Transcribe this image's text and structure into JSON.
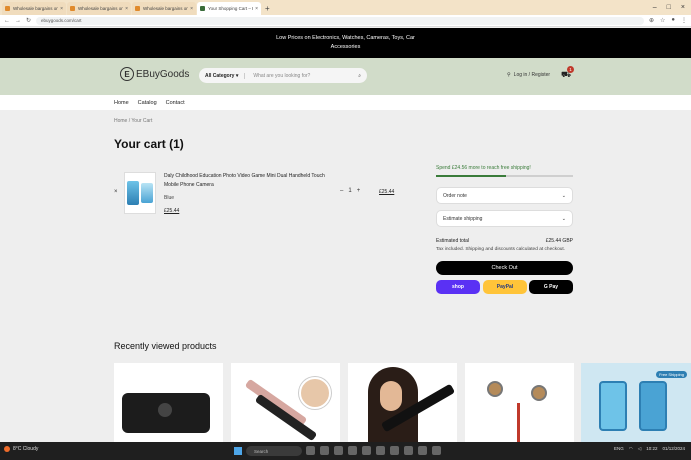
{
  "browser": {
    "tabs": [
      {
        "label": "Wholesale bargains online...",
        "active": false
      },
      {
        "label": "Wholesale bargains online...",
        "active": false
      },
      {
        "label": "Wholesale bargains online...",
        "active": false
      },
      {
        "label": "Your Shopping Cart – EBuyGoods",
        "active": true
      }
    ],
    "url": "ebuygoods.com/cart"
  },
  "announcement": "Low Prices on Electronics, Watches, Cameras, Toys, Car Accessories",
  "header": {
    "logo_mark": "E",
    "logo_text": "EBuyGoods",
    "category_label": "All Category ▾",
    "search_placeholder": "What are you looking for?",
    "login_label": "Log in / Register",
    "cart_count": "1"
  },
  "nav": [
    "Home",
    "Catalog",
    "Contact"
  ],
  "breadcrumb": "Home  /  Your Cart",
  "page_title": "Your cart (1)",
  "cart_item": {
    "name": "Daly Childhood Education Photo Video Game Mini Dual Handheld Touch Mobile Phone Camera",
    "sku": "Blue",
    "price": "£25.44",
    "quantity": "1",
    "line_total": "£25.44"
  },
  "sidebar": {
    "shipping_message": "Spend £24.56 more to reach free shipping!",
    "shipping_progress": 0.51,
    "order_note_label": "Order note",
    "estimate_label": "Estimate shipping",
    "estimated_total_label": "Estimated total",
    "estimated_total_value": "£25.44 GBP",
    "tax_note": "Tax included. Shipping and discounts calculated at checkout.",
    "checkout_label": "Check Out",
    "shop_pay_label": "shop",
    "paypal_label": "PayPal",
    "gpay_label": "G Pay"
  },
  "recently_viewed": {
    "title": "Recently viewed products",
    "tag": "Free Shipping"
  },
  "taskbar": {
    "weather_temp": "8°C",
    "weather_desc": "Cloudy",
    "search_placeholder": "Search",
    "time": "10:22",
    "date": "01/12/2024",
    "lang": "ENG"
  },
  "colors": {
    "header_bg": "#d1dcc9",
    "accent_green": "#3a7c3a",
    "checkout_bg": "#000000",
    "shop_pay": "#5a31f4",
    "paypal": "#ffc439"
  }
}
